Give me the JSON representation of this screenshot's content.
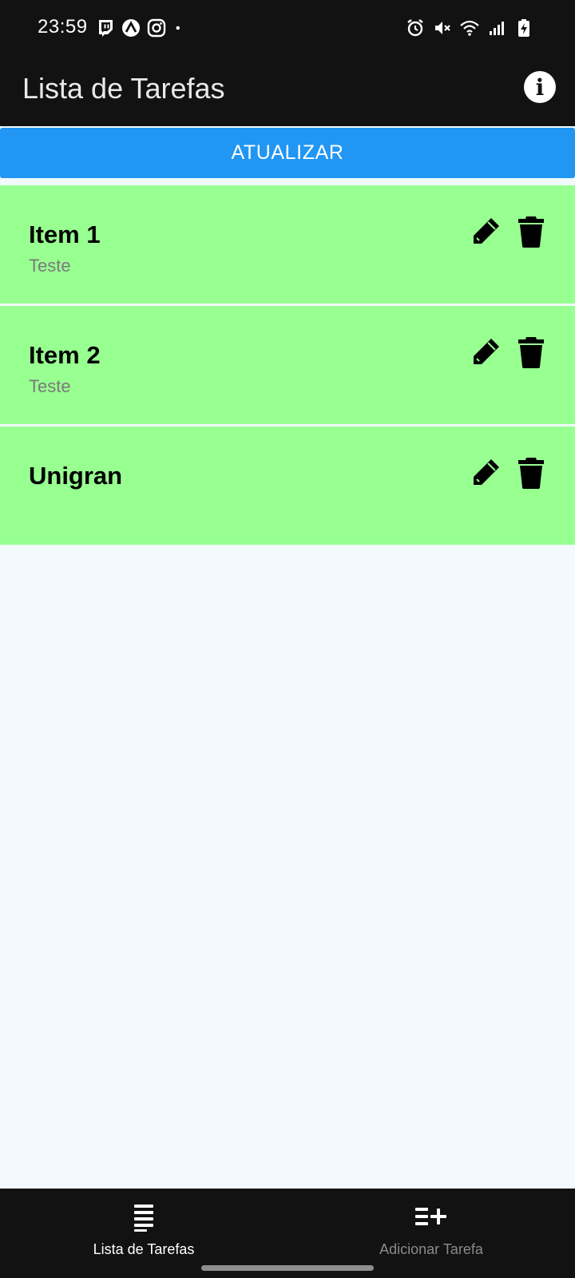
{
  "status_bar": {
    "time": "23:59",
    "left_icons": [
      "twitch-icon",
      "arc-icon",
      "instagram-icon",
      "dot-icon"
    ],
    "right_icons": [
      "alarm-icon",
      "mute-icon",
      "wifi-icon",
      "signal-icon",
      "battery-charging-icon"
    ]
  },
  "app_bar": {
    "title": "Lista de Tarefas",
    "info_icon": "info-icon"
  },
  "refresh_button": {
    "label": "ATUALIZAR",
    "color": "#2196f3"
  },
  "tasks": [
    {
      "title": "Item 1",
      "description": "Teste"
    },
    {
      "title": "Item 2",
      "description": "Teste"
    },
    {
      "title": "Unigran",
      "description": ""
    }
  ],
  "task_item_color": "#98ff91",
  "bottom_nav": {
    "tabs": [
      {
        "label": "Lista de Tarefas",
        "icon": "list-icon",
        "active": true
      },
      {
        "label": "Adicionar Tarefa",
        "icon": "add-list-icon",
        "active": false
      }
    ]
  }
}
